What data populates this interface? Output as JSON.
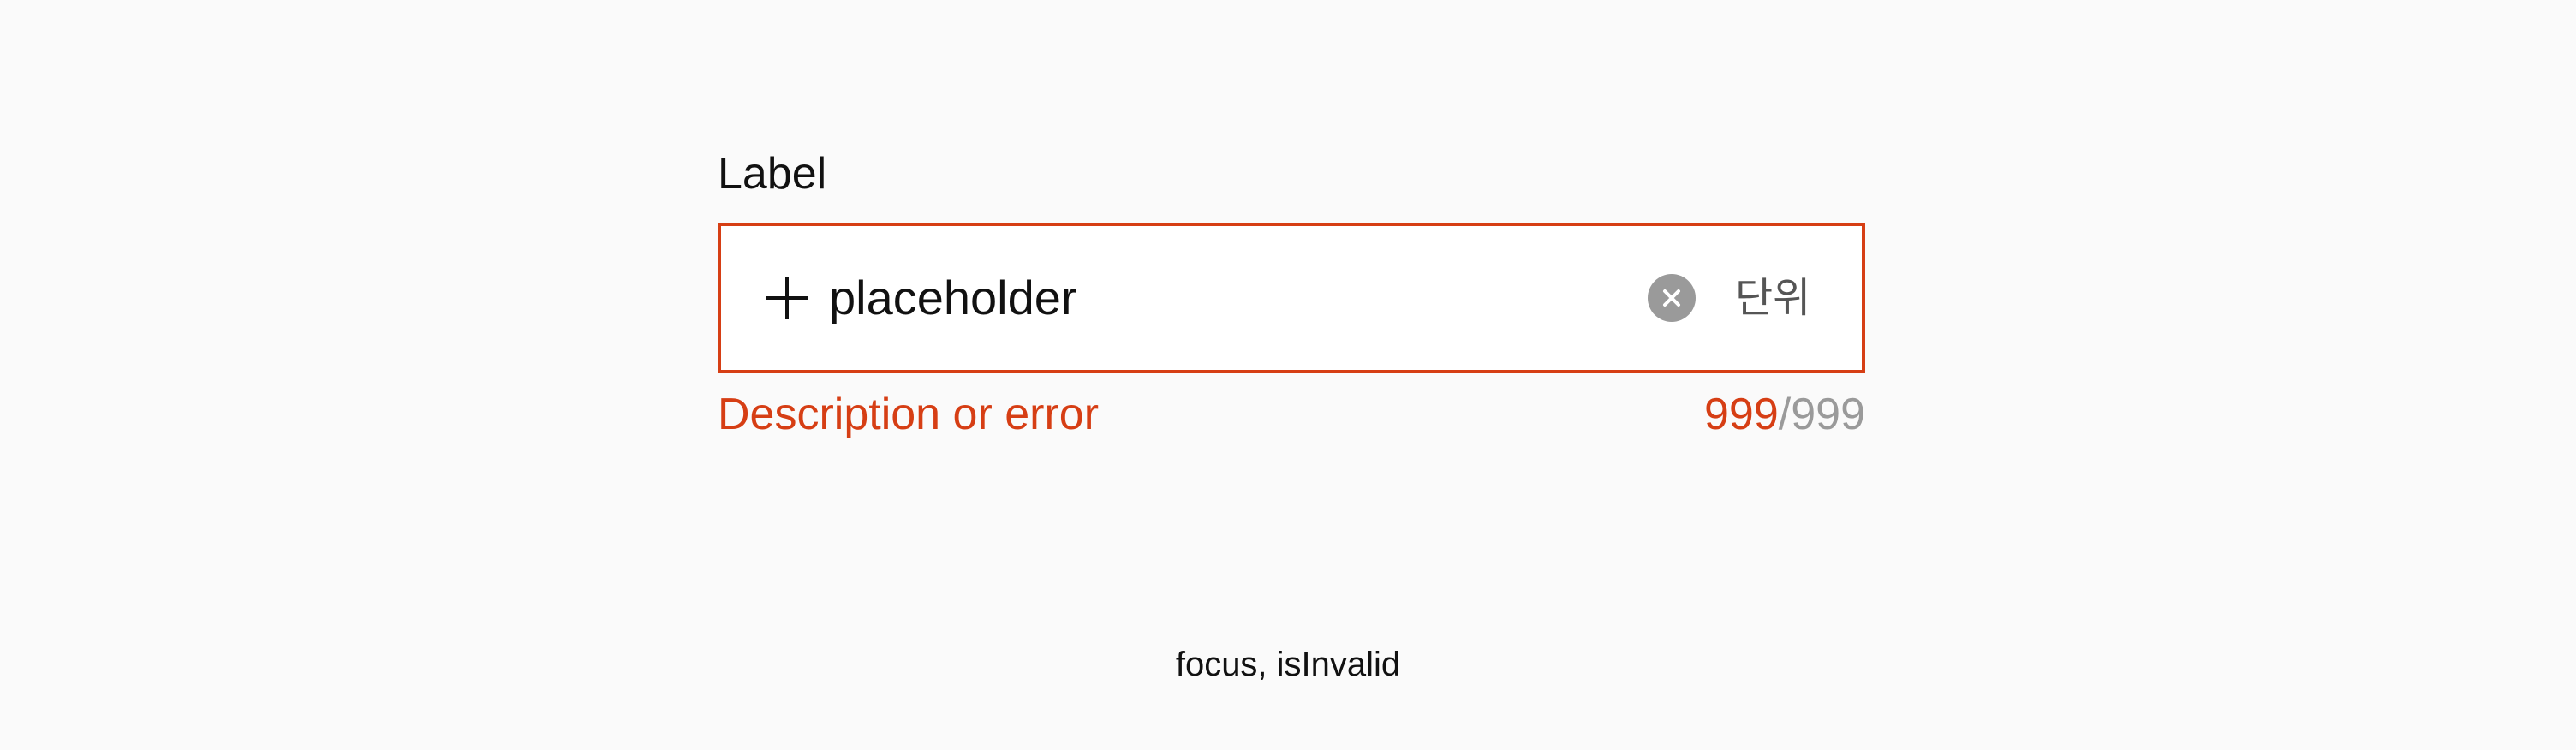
{
  "field": {
    "label": "Label",
    "input_value": "",
    "placeholder": "placeholder",
    "unit": "단위",
    "description": "Description or error",
    "counter": {
      "current": "999",
      "separator": "/",
      "max": "999"
    },
    "icons": {
      "leading": "plus-icon",
      "clear": "clear-icon"
    }
  },
  "caption": "focus, isInvalid",
  "colors": {
    "background": "#fafafa",
    "input_background": "#ffffff",
    "error": "#d63e14",
    "muted": "#9a9a9a",
    "text": "#111111"
  }
}
